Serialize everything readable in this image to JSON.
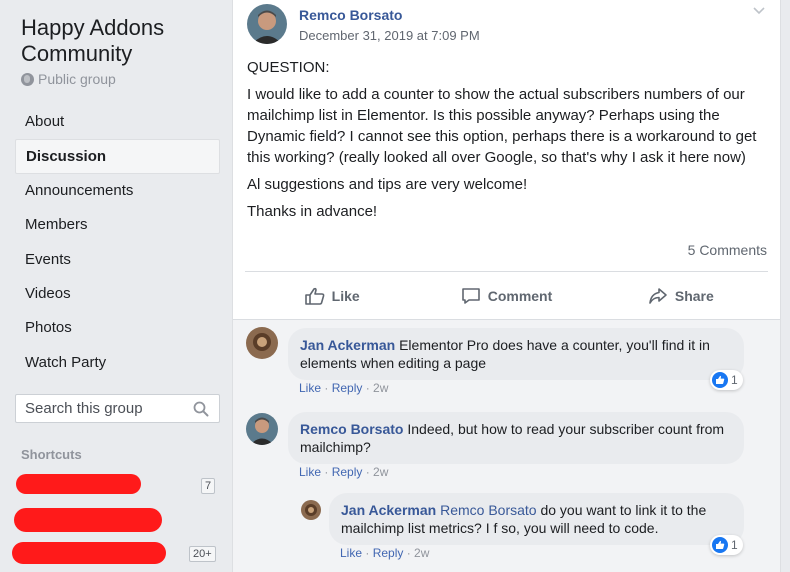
{
  "group": {
    "title": "Happy Addons Community",
    "privacy": "Public group"
  },
  "nav": {
    "items": [
      {
        "label": "About",
        "active": false
      },
      {
        "label": "Discussion",
        "active": true
      },
      {
        "label": "Announcements",
        "active": false
      },
      {
        "label": "Members",
        "active": false
      },
      {
        "label": "Events",
        "active": false
      },
      {
        "label": "Videos",
        "active": false
      },
      {
        "label": "Photos",
        "active": false
      },
      {
        "label": "Watch Party",
        "active": false
      }
    ]
  },
  "search": {
    "placeholder": "Search this group"
  },
  "shortcuts": {
    "title": "Shortcuts",
    "badges": [
      "7",
      "20+"
    ]
  },
  "post": {
    "author": "Remco Borsato",
    "date": "December 31, 2019 at 7:09 PM",
    "body": [
      "QUESTION:",
      "I would like to add a counter to show the actual subscribers numbers of our mailchimp list in Elementor. Is this possible anyway? Perhaps using the Dynamic field? I cannot see this option, perhaps there is a workaround to get this working? (really looked all over Google, so that's why I ask it here now)",
      "Al suggestions and tips are very welcome!",
      "Thanks in advance!"
    ],
    "comments_count": "5 Comments",
    "actions": {
      "like": "Like",
      "comment": "Comment",
      "share": "Share"
    }
  },
  "comments": [
    {
      "author": "Jan Ackerman",
      "mention": "",
      "text": "Elementor Pro does have a counter, you'll find it in elements when editing a page",
      "like": "Like",
      "reply": "Reply",
      "time": "2w",
      "reactions": "1"
    },
    {
      "author": "Remco Borsato",
      "mention": "",
      "text": "Indeed, but how to read your subscriber count from mailchimp?",
      "like": "Like",
      "reply": "Reply",
      "time": "2w",
      "reactions": ""
    },
    {
      "author": "Jan Ackerman",
      "mention": "Remco Borsato",
      "text": "do you want to link it to the mailchimp list metrics? I f so, you will need to code.",
      "like": "Like",
      "reply": "Reply",
      "time": "2w",
      "reactions": "1"
    }
  ],
  "colors": {
    "link": "#385898",
    "like_blue": "#1877f2",
    "redaction": "#ff1a1a"
  }
}
